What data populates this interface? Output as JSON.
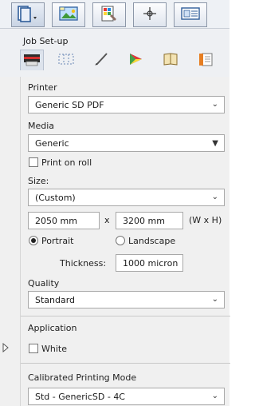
{
  "toolbar": {
    "icons": [
      "page-icon",
      "image-icon",
      "color-swatch-icon",
      "crosshair-icon",
      "layout-icon"
    ]
  },
  "header": {
    "title": "Job Set-up",
    "tabs": [
      "printer-tab-icon",
      "grid-tab-icon",
      "pen-tab-icon",
      "color-tab-icon",
      "book-tab-icon",
      "document-tab-icon"
    ]
  },
  "printer": {
    "label": "Printer",
    "value": "Generic SD PDF"
  },
  "media": {
    "label": "Media",
    "value": "Generic"
  },
  "print_on_roll": {
    "label": "Print on roll"
  },
  "size": {
    "label": "Size:",
    "value": "(Custom)",
    "width": "2050 mm",
    "height": "3200 mm",
    "x_label": "x",
    "unit_label": "(W x H)"
  },
  "orientation": {
    "portrait": "Portrait",
    "landscape": "Landscape"
  },
  "thickness": {
    "label": "Thickness:",
    "value": "1000 micron"
  },
  "quality": {
    "label": "Quality",
    "value": "Standard"
  },
  "application": {
    "label": "Application",
    "white_label": "White"
  },
  "calibrated": {
    "label": "Calibrated Printing Mode",
    "value": "Std - GenericSD - 4C"
  }
}
